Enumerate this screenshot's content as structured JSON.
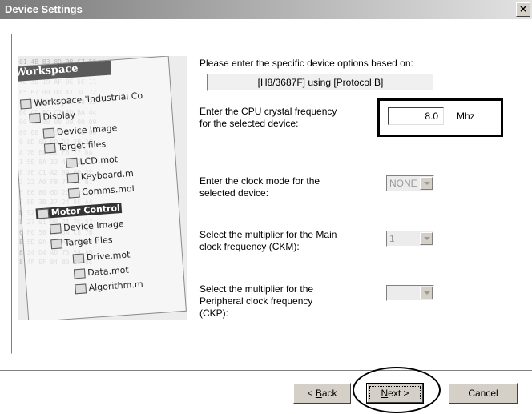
{
  "window": {
    "title": "Device Settings",
    "close_glyph": "×"
  },
  "image_panel": {
    "header": "Workspace",
    "tree": [
      {
        "label": "Workspace 'Industrial Co",
        "highlight": false
      },
      {
        "label": "Display",
        "highlight": false
      },
      {
        "label": "Device Image",
        "highlight": false
      },
      {
        "label": "Target files",
        "highlight": false
      },
      {
        "label": "LCD.mot",
        "highlight": false
      },
      {
        "label": "Keyboard.m",
        "highlight": false
      },
      {
        "label": "Comms.mot",
        "highlight": false
      },
      {
        "label": "Motor Control",
        "highlight": true
      },
      {
        "label": "Device Image",
        "highlight": false
      },
      {
        "label": "Target files",
        "highlight": false
      },
      {
        "label": "Drive.mot",
        "highlight": false
      },
      {
        "label": "Data.mot",
        "highlight": false
      },
      {
        "label": "Algorithm.m",
        "highlight": false
      }
    ]
  },
  "intro": {
    "text": "Please enter the specific device options based on:",
    "device_info": "[H8/3687F]  using  [Protocol B]"
  },
  "cpu_freq": {
    "label_line1": "Enter the CPU crystal frequency",
    "label_line2": "for the selected device:",
    "value": "8.0",
    "unit": "Mhz"
  },
  "clock_mode": {
    "label_line1": "Enter the clock mode for the",
    "label_line2": "selected device:",
    "value": "NONE"
  },
  "main_multiplier": {
    "label_line1": "Select the multiplier for the Main",
    "label_line2": "clock frequency (CKM):",
    "value": "1"
  },
  "peripheral_multiplier": {
    "label_line1": "Select the multiplier for the",
    "label_line2": "Peripheral clock frequency",
    "label_line3": "(CKP):",
    "value": ""
  },
  "buttons": {
    "back_prefix": "< ",
    "back_hotkey": "B",
    "back_rest": "ack",
    "next_hotkey": "N",
    "next_rest": "ext >",
    "cancel": "Cancel"
  }
}
